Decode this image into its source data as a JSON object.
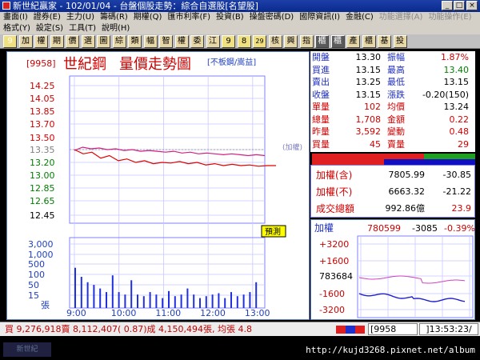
{
  "window": {
    "title": "新世紀贏家 - 102/01/04 - 台盤個股走勢：綜合自選股[名望股]"
  },
  "menu": {
    "row1": [
      "畫面(I)",
      "證券(E)",
      "主力(U)",
      "籌碼(R)",
      "期權(Q)",
      "匯市利率(F)",
      "投資(B)",
      "操盤密碼(D)",
      "國際資訊(I)",
      "金融(C)",
      "功能選擇(A)",
      "功能操作(E)"
    ],
    "row2": [
      "格式(Y)",
      "設定(S)",
      "工具(T)",
      "說明(H)"
    ]
  },
  "toolbar": {
    "buttons": [
      "9",
      "加",
      "權",
      "期",
      "價",
      "選",
      "圖",
      "綜",
      "類",
      "幅",
      "智",
      "權",
      "委",
      "江",
      "9",
      "8",
      "29",
      "核",
      "興",
      "指",
      "櫃",
      "櫃",
      "產",
      "櫃",
      "基",
      "投"
    ]
  },
  "chart": {
    "code": "[9958]",
    "name": "世紀鋼",
    "title": "量價走勢圖",
    "tag": "[不板鋼/嵩益]",
    "index_note": "(加權)",
    "preview_btn": "預測",
    "unit_label": "張",
    "price_ticks": [
      "14.25",
      "14.05",
      "13.85",
      "13.70",
      "13.50",
      "13.35",
      "13.20",
      "13.00",
      "12.85",
      "12.65",
      "12.45"
    ],
    "volume_ticks": [
      "3,000",
      "1,000",
      "500",
      "100",
      "50",
      "15"
    ],
    "time_ticks": [
      "9:00",
      "10:00",
      "11:00",
      "12:00",
      "13:00"
    ]
  },
  "chart_data": {
    "type": "line",
    "ylim": [
      12.45,
      14.25
    ],
    "reference_price": 13.35,
    "price_series": [
      13.35,
      13.3,
      13.32,
      13.25,
      13.28,
      13.22,
      13.24,
      13.2,
      13.22,
      13.18,
      13.2,
      13.19,
      13.21,
      13.18,
      13.2,
      13.16,
      13.18,
      13.15,
      13.17,
      13.15,
      13.16,
      13.14,
      13.15,
      13.15
    ],
    "index_series": [
      13.34,
      13.38,
      13.36,
      13.37,
      13.35,
      13.36,
      13.34,
      13.35,
      13.33,
      13.34,
      13.33,
      13.32,
      13.33,
      13.31,
      13.32,
      13.3,
      13.31,
      13.3,
      13.29,
      13.3,
      13.29,
      13.28,
      13.29,
      13.28
    ],
    "volume_series": [
      600,
      220,
      120,
      90,
      60,
      40,
      260,
      40,
      30,
      150,
      30,
      25,
      40,
      30,
      20,
      45,
      25,
      30,
      60,
      30,
      20,
      25,
      30,
      35,
      20,
      40,
      25,
      30,
      40,
      120
    ]
  },
  "quote": {
    "rows": [
      {
        "l1": "開盤",
        "v1": "13.30",
        "c1": "#000000",
        "l2": "振幅",
        "v2": "1.87%",
        "c2": "#d00000"
      },
      {
        "l1": "買進",
        "v1": "13.15",
        "c1": "#000000",
        "l2": "最高",
        "v2": "13.40",
        "c2": "#008000"
      },
      {
        "l1": "賣出",
        "v1": "13.25",
        "c1": "#000000",
        "l2": "最低",
        "v2": "13.15",
        "c2": "#000000"
      },
      {
        "l1": "收盤",
        "v1": "13.15",
        "c1": "#000000",
        "l2": "漲跌",
        "v2": "-0.20(150)",
        "c2": "#000000"
      },
      {
        "l1": "單量",
        "v1": "102",
        "c1": "#d00000",
        "l2": "均價",
        "v2": "13.24",
        "c2": "#000000"
      },
      {
        "l1": "總量",
        "v1": "1,708",
        "c1": "#d00000",
        "l2": "金額",
        "v2": "0.22",
        "c2": "#d00000"
      },
      {
        "l1": "昨量",
        "v1": "3,592",
        "c1": "#d00000",
        "l2": "變動",
        "v2": "0.48",
        "c2": "#d00000"
      },
      {
        "l1": "買量",
        "v1": "45",
        "c1": "#d00000",
        "l2": "賣量",
        "v2": "29",
        "c2": "#d00000"
      }
    ]
  },
  "index_panel": {
    "rows": [
      {
        "label": "加權(含)",
        "value": "7805.99",
        "change": "-30.85"
      },
      {
        "label": "加權(不)",
        "value": "6663.32",
        "change": "-21.22"
      },
      {
        "label": "成交總額",
        "value": "992.86億",
        "change": "23.9"
      }
    ]
  },
  "mini": {
    "label": "加權",
    "value": "780599",
    "change": "-3085",
    "percent": "-0.39%",
    "ticks": [
      "+3200",
      "+1600",
      "783684",
      "-1600",
      "-3200"
    ]
  },
  "status": {
    "ticker": "買 9,276,918賣 8,112,407( 0.87)成 4,150,494張, 均張 4.8",
    "stock_input": "[9958",
    "clock": "]13:53:23/"
  },
  "url": "http://kujd3268.pixnet.net/album"
}
